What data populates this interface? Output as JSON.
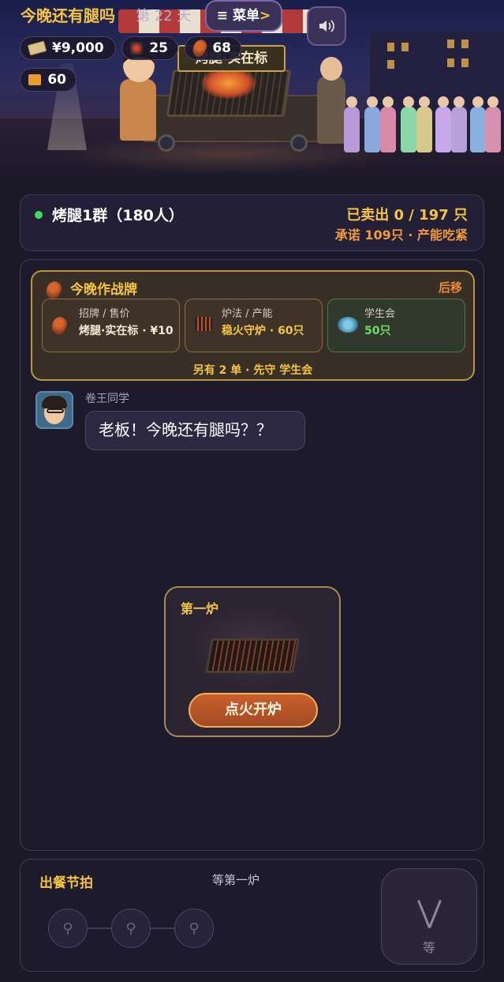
{
  "hud": {
    "title": "今晚还有腿吗",
    "day": "第 22 天",
    "menu_label": "菜单",
    "menu_arrow": ">",
    "sound_icon": "speaker-icon",
    "money": "¥9,000",
    "coal": "25",
    "legs": "68",
    "tickets": "60"
  },
  "scene": {
    "sign": "烤腿·实在标"
  },
  "group": {
    "name": "烤腿1群（180人）",
    "sold": "已卖出 0 / 197 只",
    "promise": "承诺 109只 · 产能吃紧",
    "status_color": "#3ddc6a"
  },
  "battle": {
    "title": "今晚作战牌",
    "move": "后移",
    "slots": [
      {
        "label": "招牌 / 售价",
        "value": "烤腿·实在标 · ¥10",
        "icon": "drumstick-icon"
      },
      {
        "label": "炉法 / 产能",
        "value": "稳火守炉 · 60只",
        "icon": "grill-icon"
      },
      {
        "label": "学生会",
        "value": "50只",
        "icon": "council-icon"
      }
    ],
    "footer": "另有 2 单 · 先守 学生会"
  },
  "chat": {
    "speaker": "卷王同学",
    "message": "老板！今晚还有腿吗？？"
  },
  "stove": {
    "title": "第一炉",
    "button": "点火开炉"
  },
  "rhythm": {
    "title": "出餐节拍",
    "status": "等第一炉",
    "wait_label": "等"
  },
  "colors": {
    "accent_gold": "#f5c542",
    "accent_orange": "#e98a3a",
    "positive_green": "#6fdc6a"
  }
}
